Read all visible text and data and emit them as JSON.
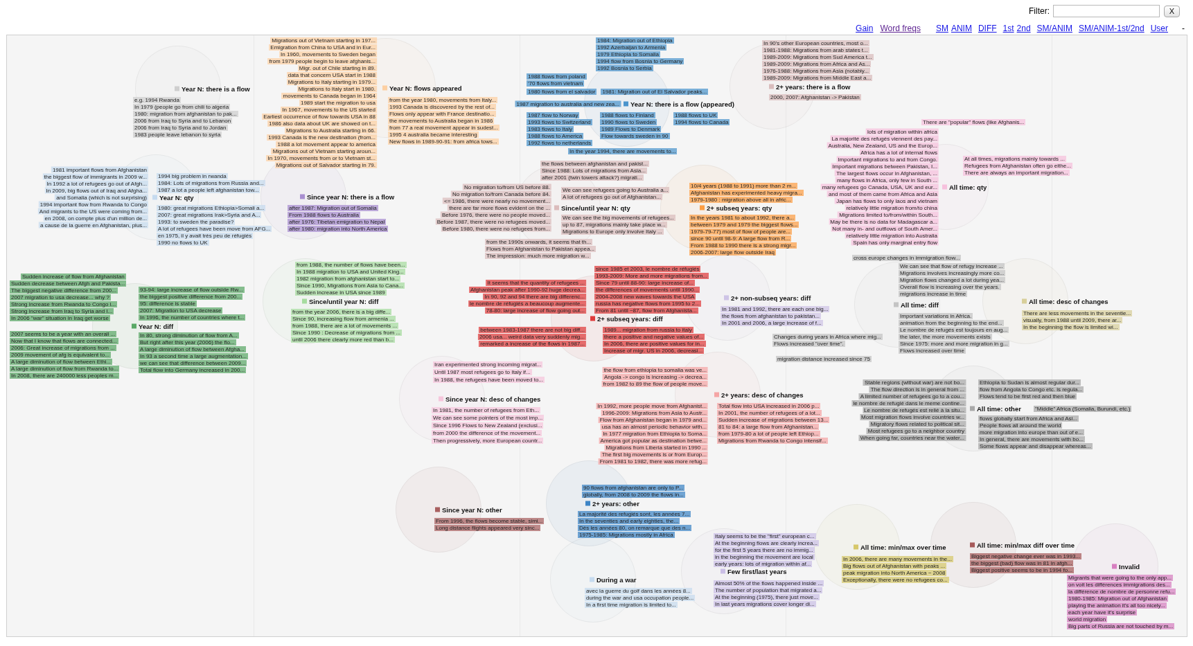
{
  "filter": {
    "label": "Filter:",
    "clear_button": "X"
  },
  "nav": {
    "tools": [
      {
        "label": "Gain",
        "visited": false
      },
      {
        "label": "Word freqs",
        "visited": true
      }
    ],
    "views": [
      {
        "links": [
          {
            "label": "SM",
            "visited": false
          },
          {
            "label": "ANIM",
            "visited": false
          }
        ]
      },
      {
        "links": [
          {
            "label": "DIFF",
            "visited": false
          }
        ]
      },
      {
        "links": [
          {
            "label": "1st",
            "visited": false
          },
          {
            "label": "2nd",
            "visited": false
          }
        ]
      },
      {
        "links": [
          {
            "label": "SM/ANIM",
            "visited": false
          }
        ]
      },
      {
        "links": [
          {
            "label": "SM/ANIM-1st/2nd",
            "visited": false
          }
        ]
      },
      {
        "links": [
          {
            "label": "User",
            "visited": false
          }
        ]
      }
    ],
    "trailing": "-"
  },
  "clusters": [
    {
      "label": "Year N: there is a flow",
      "color": "#cfcfcf",
      "notes": [
        "e.g. 1994 Rwanda",
        "In 1979 (people go from chili to algeria",
        "1980: migration from afghanistan to pak...",
        "2006 from Iraq to Syria and to Lebanon",
        "2006 from Iraq to Syria and to Jordan",
        "1983 people leave lebanon to syria"
      ]
    },
    {
      "label": "Year N: flows appeared",
      "color": "#fdd0a2",
      "notes": [
        "Migrations out of Vietnam starting in 197...",
        "Emigration from China to USA and in Eur...",
        "In 1960, movements to Sweden began",
        "from 1979 people begin to leave afghanis...",
        "Migr. out of Chile starting in 89.",
        "data that concern USA start in 1988",
        "Migrations to Italy starting in 1979...",
        "Migrations to Italy start in 1980.",
        "movements to Canada began in 1964",
        "1989 start the migration to usa",
        "In 1967, movements to the US started",
        "Earliest occurrence of flow towards USA in 88",
        "1986 also data about UK are showed on t...",
        "Migrations to Australia starting in 66.",
        "1993 Canada is the new destination (from...",
        "1988 a lot movement appear to america",
        "Migrations out of Vietnam starting aroun...",
        "In 1970, movements from or to Vietnam st...",
        "Migrations out of Salvador starting in 79.",
        "from the year 1980, movements from Italy...",
        "1993 Canada is discovered by the rest of...",
        "Flows only appear with France destinatio...",
        "the movements to Australia began in 1986",
        "from 77 a real movement appear in sudest...",
        "1995 4 australia became interesting",
        "New flows in 1989-90-91: from africa tows..."
      ]
    },
    {
      "label": "Year N: there is a flow (appeared)",
      "color": "#4b94cc",
      "notes": [
        "1984: Migration out of Ethiopia",
        "1992 Azerbaijan to Armenia",
        "1979 Ethiopia to Somalia",
        "1994 flow from Bosnia to Germany",
        "1992 Bosnia to Serbia",
        "1988 flows from poland",
        "'70 flows from vietnam",
        "1980 flows from el salvador",
        "1981: Migration out of El Salvador peaks...",
        "1987 migration to australia and new zea...",
        "1987 flow to Norway",
        "1993 flows to Switzerland",
        "1983 flows to Italy",
        "1988 flows to America",
        "1992 flows to netherlands",
        "1988 flows to Finland",
        "1990 flows to Sweden",
        "1989 Flows to Denmark",
        "Flow towards sweden in 90",
        "1988 flows to UK",
        "1994 flows to Canada",
        "In the year 1994, there are movements to..."
      ]
    },
    {
      "label": "2+ years: there is a flow",
      "color": "#d9bcbc",
      "notes": [
        "In 90's other European countries, most o...",
        "1981-1988: Migrations from arab states t...",
        "1989-2009: Migrations from Sud America t...",
        "1989-2009: Migrations from Africa and As...",
        "1976-1988: Migrations from Asia (notably...",
        "1989-2009: Migrations from Middle East a...",
        "2000, 2007: Afghanistan -> Pakistan"
      ]
    },
    {
      "label": "Year N: qty",
      "color": "#c6dbef",
      "notes": [
        "1981 important flows from Afghanistan",
        "the biggest flow of immigrants in 2009 w...",
        "In 1992 a lot of refugees go out of Afgh...",
        "In 2009, big flows out of Iraq and Afgha...",
        "and Somalia (which is not surprising)",
        "1994 important flow from Rwanda to Congo",
        "And migrants to the US were coming from...",
        "en 2008, on compte plus d'un million de...",
        "a cause de la guerre en Afghanistan, plus...",
        "1994 big problem in rwanda",
        "1984: Lots of migrations from Russia and...",
        "1987 a lot a people left afghanistan tow...",
        "1980: great migrations Ethiopia>Somali a...",
        "2007: great migrations Irak>Syria and A...",
        "1993: to sweden the paradise?",
        "A lot of refugees have been move from AFG...",
        "en 1975, il y avait très peu de réfugiés",
        "1990 no flows to UK"
      ]
    },
    {
      "label": "Since year N: there is a flow",
      "color": "#a88ed0",
      "notes": [
        "after 1987: Migration out of Somalia",
        "From 1988 flows to Australia",
        "after 1976: Tibetan emigration to Nepal",
        "after 1980: migration into North America"
      ]
    },
    {
      "label": "Since/until year N: qty",
      "color": "#dbbcbc",
      "notes": [
        "the flows between afghanistan and pakist...",
        "Since 1988: Lots of migrations from Asia...",
        "after 2001 (twin towers attack?) migrati...",
        "No migration to/from US before 88.",
        "No migration to/from Canada before 84.",
        "<= 1986, there were nearly no movement...",
        "there are far more flows evident on the ...",
        "Before 1976, there were no people moved...",
        "Before 1987, there were no refugees moved...",
        "Before 1980, there were no refugees from...",
        "We can see refugees going to Australia a...",
        "A lot of refugees go out of Afghanistan...",
        "We can see the big movements of refugees...",
        "up to 87, migrations mainly take place w...",
        "Migrations to Europe only involve Italy ...",
        "from the 1990s onwards, it seems that th...",
        "Flows from Afghanistan to Pakistan appea...",
        "The impression: much more migration w..."
      ]
    },
    {
      "label": "2+ subseq years: qty",
      "color": "#fd9e44",
      "notes": [
        "10/4 years (1988 to 1991) more than 2 m...",
        "Afghanistan has experimented heavy migra...",
        "1979-1980 : migration above all in afric...",
        "In the years 1981 to about 1992, there a...",
        "between 1979 and 1979 the biggest flows...",
        "1979-79-77) most of flow of people are...",
        "since 90 until 98-9: A large flow from R...",
        "From 1988 to 1990 there is a strong migr...",
        "2006-2007: large flow outside Iraq"
      ]
    },
    {
      "label": "All time: qty",
      "color": "#f6c1dd",
      "notes": [
        "There are \"popular\" flows (like Afghanis...",
        "lots of migration within africa",
        "La majorité des refugés viennent des pay...",
        "Australia, New Zealand, US and the Europ...",
        "Africa has a lot of internal flows",
        "Important migrations to and from Congo.",
        "Important migrations between Pakistan, I...",
        "The largest flows occur in Afghanistan, ...",
        "many flows in Africa, only few in South ...",
        "many refugees go Canada, USA, UK and eur...",
        "and most of them came from Africa and Asia",
        "Japan has flows to only laos and vietnam",
        "relatively little migration from/to china",
        "Migrations limited to/from/within South...",
        "May be there is no data for Madagascar a...",
        "Not many in- and outflows of South Amer...",
        "relatively little migration into Australia",
        "Spain has only marginal entry flow",
        "At all times, migrations mainly towards ...",
        "Refugees from Afghanistan often go eithe...",
        "There are always an important migration..."
      ]
    },
    {
      "label": "Year N: diff",
      "color": "#5aa866",
      "notes": [
        "Sudden increase of flow from Afghanistan",
        "Sudden decrease between Afgh and Pakista...",
        "The biggest negative difference from 200...",
        "2007 migration to usa decrease... why ?",
        "Strong increase from Rwanda to Congo i...",
        "Strong increase from Iraq to Syria and I...",
        "In 2006 \"war\" situation in Iraq get worse",
        "93-94: large increase of flow outside Rw...",
        "the biggest positive difference from 200...",
        "95: difference is stable",
        "2007: Migration to USA decrease",
        "In 1996, the number of countries where t...",
        "2007 seems to be a year with an overall ...",
        "Now that I know that flows are connected...",
        "2006: Great increase of migrations from ...",
        "2009 movement of afg is equivalent to...",
        "A large diminution of flow between Ethi...",
        "A large diminution of flow from Rwanda to...",
        "In 2008, there are 240000 less peoples m...",
        "In 80, strong diminution of flow from A...",
        "But right after this year (2006) the flo...",
        "A large diminution of flow between Afgha...",
        "In 93 a second time a large augmentation...",
        "we can see that difference between 2009...",
        "Total flow into Germany increased in 200..."
      ]
    },
    {
      "label": "Since/until year N: diff",
      "color": "#a6dc9f",
      "notes": [
        "from 1988, the number of flows have been...",
        "In 1988 migration to USA and United King...",
        "1982 migration from afghanistan start to...",
        "Since 1990, Migrations from Asia to Cana...",
        "Sudden increase in USA since 1989",
        "from the year 2006, there is a big diffe...",
        "Since 90, increasing flow from armenia ...",
        "from 1988, there are a lot of movements ...",
        "Since 1990 : Decrease of migrations from ...",
        "until 2006 there clearly more red than b..."
      ]
    },
    {
      "label": "2+ subseq years: diff",
      "color": "#df3a3a",
      "notes": [
        "It seems that the quantity of refugees ...",
        "Afghanistan peak after 1990-92 huge decrea...",
        "In 90, 92 and 94 there are big differenc...",
        "le nombre de réfugiés a beaucoup augmente...",
        "78-80: large increase of flow going out...",
        "since 1985 et 2003, le nombre de réfugiés",
        "1993-2009: More and more migrations from...",
        "Since 79 until 88-90: large increase of...",
        "the differences of movements until 1990...",
        "2004-2008 new waves towards the USA",
        "russia has negative flows from 1995 to 2...",
        "From 81 until ~87, flow from Afghanista...",
        "between 1983-1987 there are not big diff...",
        "2006 usa... weird data very suddenly mig...",
        "remarked a increase of the flows in 1987...",
        "1989... migration from russia to italy",
        "there a positive and negative values of...",
        "In 2006, there are positive values for in...",
        "Increase of migr. US in 2006, decreasi..."
      ]
    },
    {
      "label": "2+ non-subseq years: diff",
      "color": "#cec4e6",
      "notes": [
        "In 1981 and 1992, there are each one big...",
        "the flows from afghanistan to pakistan...",
        "In 2001 and 2006, a large increase of f..."
      ]
    },
    {
      "label": "All time: diff",
      "color": "#c4c4c4",
      "notes": [
        "cross europe changes in immigration flow...",
        "We can see that flow of refugy increase ...",
        "Migrations involves increasingly more co...",
        "Migration flows changed a lot during yea...",
        "Overall flow is increasing over the years.",
        "migrations increase in time",
        "Changes during years in Africa where mig...",
        "Flows increased \"over time\".",
        "Important variations in Africa.",
        "animation from the beginning to the end...",
        "Le nombre de refugés est toujours en aug...",
        "the later, the more movements exists",
        "Since 1975: more and more migration in g...",
        "Flows increased over time",
        "migration distance increased since 75"
      ]
    },
    {
      "label": "All time: desc of changes",
      "color": "#d8cf9a",
      "notes": [
        "There are less movements in the seventie...",
        "visually, from 1988 until 2009, there ar...",
        "In the beginning the flow is limited wi..."
      ]
    },
    {
      "label": "Since year N: desc of changes",
      "color": "#f6c6dc",
      "notes": [
        "Iran experimented strong incoming migrat...",
        "Until 1987 most refugees go to Italy if...",
        "In 1988, the refugees have been moved to...",
        "In 1981, the number of refugees from Eth...",
        "We can see some pointers of the most imp...",
        "Since 1996 Flows to New Zealand (exclusi...",
        "from 2000 the difference of the movement...",
        "Then progressively, more European countr..."
      ]
    },
    {
      "label": "2+ years: desc of changes",
      "color": "#f5a5a5",
      "notes": [
        "the flow from ethiopia to somalia was ve...",
        "Angola -> congo is increasing -> decrea...",
        "from 1982 to 89 the flow of people move...",
        "In 1992, more people move from Afghanist...",
        "1996-2009: Migrations from Asia to Austr...",
        "Flow from Afghanistan began in 1979 and...",
        "usa has an almost periodic behavior with...",
        "In 1977 migration from Ethiopia to Soma...",
        "America got popular as destination betwe...",
        "Migrations from Liberia started in 1990 ...",
        "The first big movements is or from Europ...",
        "From 1981 to 1982, there was more refug...",
        "Total flow into USA increased in 2006 p...",
        "In 2001, the number of refugees of a lot...",
        "Sudden increase of migrations between 13...",
        "81 to 84: a large flow from Afghanistan...",
        "from 1979-80 a lot of people left Ethiop...",
        "Migrations from Rwanda to Congo intensif..."
      ]
    },
    {
      "label": "All time: other",
      "color": "#a9a9a9",
      "notes": [
        "Stable regions (without war) are not bo...",
        "The flow direction is in general from ...",
        "A limited number of refugees go to a cou...",
        "le nombre de refugié dans le meme contine...",
        "Le nombre de refugés est relié à la situ...",
        "Most migration flows involve countries w...",
        "Migratory flows related to political sit...",
        "Most refugees go to a neighbor country",
        "When going far, countries near the water...",
        "Ethiopia to Sudan is almost regular dur...",
        "flow from Angola to Congo etc. is regula...",
        "Flows tend to be first red and then blue",
        "\"Middle\" Africa (Somalia, Burundi, etc.)",
        "flows globally start from Africa and Asi...",
        "People flows all around the world",
        "more migration into europe than out of e...",
        "In general, there are movements with bo...",
        "Some flows appear and disappear whereas..."
      ]
    },
    {
      "label": "Since year N: other",
      "color": "#a86060",
      "notes": [
        "From 1996, the flows become stable, simi...",
        "Long distance flights appeared very sinc..."
      ]
    },
    {
      "label": "2+ years: other",
      "color": "#3d85c6",
      "notes": [
        "90 flows from afghanistan are only to P...",
        "globally, from 2008 to 2009 the flows in...",
        "La majorité des refugiés sont, les années 7...",
        "In the seventies and early eighties, the...",
        "Dès les années 80, on remarque que des n...",
        "1975-1985: Migrations mostly in Africa"
      ]
    },
    {
      "label": "During a war",
      "color": "#c6dbef",
      "notes": [
        "avec la guerre du golf dans les années 8...",
        "during the war and usa occupation people...",
        "In a first time migration is limited to..."
      ]
    },
    {
      "label": "Few first/last years",
      "color": "#cbbfe6",
      "notes": [
        "Italy seems to be the \"first\" european c...",
        "At the beginning flows are clearly increa...",
        "for the first 5 years there are no immig...",
        "in the beginning the movement are local",
        "early years: lots of migration within af...",
        "Almost 50% of the flows happened inside ...",
        "The number of population that migrated a...",
        "At the beginning (1975), there just move...",
        "In last years migrations cover longer di..."
      ]
    },
    {
      "label": "All time: min/max over time",
      "color": "#d6c86a",
      "notes": [
        "In 2006, there are many movements in the...",
        "Big flows out of Afghanistan with peaks ...",
        "peak migration into North America ~ 2008",
        "Exceptionally, there were no refugees co..."
      ]
    },
    {
      "label": "All time: min/max diff over time",
      "color": "#a65a5a",
      "notes": [
        "Biggest negative change ever was in 1993...",
        "the biggest (bad) flow was in 81 in afgh...",
        "Biggest positive seems to be in 1994 fo..."
      ]
    },
    {
      "label": "Invalid",
      "color": "#d77fc0",
      "notes": [
        "Migrants that were going to the only app...",
        "on voit les différences immigrations des...",
        "la différence de nombre de personne refu...",
        "1980-1985: Migration out of Afghanistan",
        "playing the animation it's all too nicely...",
        "each year have it's surprise",
        "world migration",
        "Big parts of Russia are not touched by m..."
      ]
    }
  ]
}
